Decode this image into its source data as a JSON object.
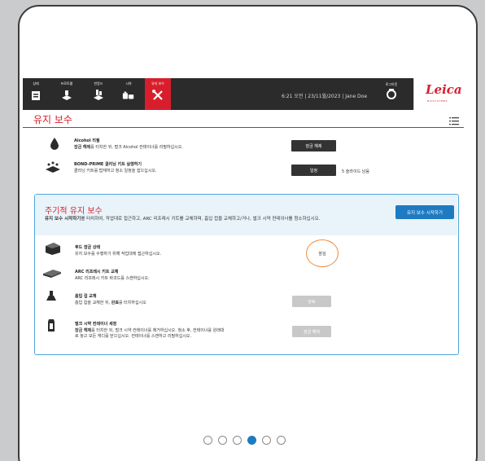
{
  "nav": {
    "items": [
      {
        "label": "상태",
        "icon": "status-icon"
      },
      {
        "label": "프로토콜",
        "icon": "protocol-icon"
      },
      {
        "label": "반응드",
        "icon": "reagent-icon"
      },
      {
        "label": "시약",
        "icon": "reagent-bottle-icon"
      },
      {
        "label": "유지 보수",
        "icon": "wrench-screwdriver-icon",
        "active": true
      }
    ],
    "status": "6:21 오전  |  23/11월/2023  |  Jane Doe",
    "login_label": "로그아웃",
    "logo_word": "Leica",
    "logo_sub": "BIOSYSTEMS",
    "accent_color": "#d81e2d"
  },
  "page": {
    "title": "유지 보수"
  },
  "rows": {
    "alcohol": {
      "title": "Alcohol 리필",
      "desc_bold": "잠금 해제",
      "desc_rest": "를 터치한 뒤, 벌크 Alcohol 컨테이너를 리필하십시오.",
      "button": "잠금 해제"
    },
    "cleaning": {
      "title": "BOND-PRIME 클리닝 키트 실행하기",
      "desc": "클리닝 키트를 탑재하고 청소 일정을 잡으십시오.",
      "button": "일정",
      "note": "5 슬라이드 남음"
    }
  },
  "pm": {
    "title": "주기적 유지 보수",
    "desc_bold": "유지 보수 시작하기",
    "desc_rest": "를 터치하여, 작업대로 접근하고, ARC 리프레시 키트를 교체하며, 흡입 컵을 교체하고/거나, 벌크 시약 컨테이너를 청소하십시오.",
    "start_button": "유지 보수 시작하기",
    "accent_color": "#1f7bc1",
    "items": {
      "hood": {
        "title": "후드 잠금 상태",
        "desc": "유지 보수를 수행하기 위해 작업대에 접근하십시오.",
        "status": "잠김"
      },
      "arc": {
        "title": "ARC 리프레시 키트 교체",
        "desc": "ARC 리프레시 키트 바코드를 스캔하십시오."
      },
      "cup": {
        "title": "흡입 컵 교체",
        "desc_pre": "흡입 컵을 교체한 뒤, ",
        "desc_bold": "완료",
        "desc_post": "를 터치하십시오",
        "button": "완료"
      },
      "bulk": {
        "title": "벌크 시약 컨테이너 세정",
        "desc_bold": "잠금 해제",
        "desc_rest": "를 터치한 뒤, 벌크 시약 컨테이너를 제거하십시오. 청소 후, 컨테이너를 원래대",
        "desc_line2": "로 놓고 모든 캐디를 닫으십시오. 컨테이너를 스캔하고 리필하십시오.",
        "button": "잠금 해제"
      }
    }
  },
  "pager": {
    "count": 6,
    "active_index": 3
  }
}
